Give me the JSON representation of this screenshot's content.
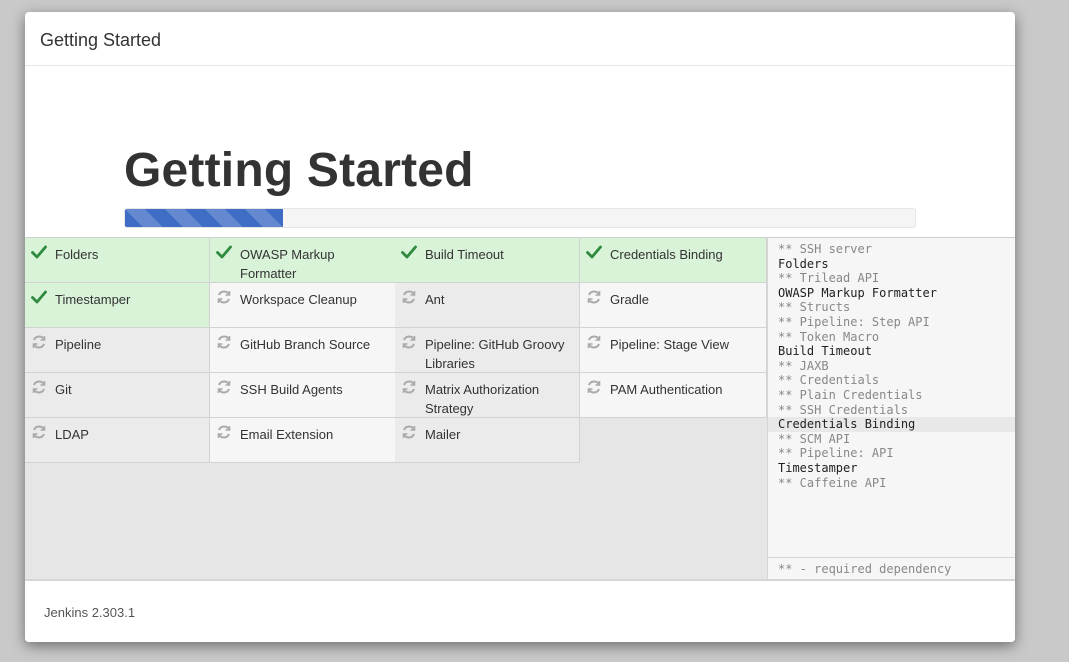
{
  "header": {
    "title": "Getting Started"
  },
  "hero": {
    "title": "Getting Started",
    "progress_fraction": 0.2
  },
  "plugins": [
    {
      "label": "Folders",
      "status": "success",
      "icon": "checkmark-icon"
    },
    {
      "label": "OWASP Markup Formatter",
      "status": "success",
      "icon": "checkmark-icon"
    },
    {
      "label": "Build Timeout",
      "status": "success",
      "icon": "checkmark-icon"
    },
    {
      "label": "Credentials Binding",
      "status": "success",
      "icon": "checkmark-icon"
    },
    {
      "label": "Timestamper",
      "status": "success",
      "icon": "checkmark-icon"
    },
    {
      "label": "Workspace Cleanup",
      "status": "pending",
      "icon": "refresh-icon"
    },
    {
      "label": "Ant",
      "status": "pending",
      "icon": "refresh-icon"
    },
    {
      "label": "Gradle",
      "status": "pending",
      "icon": "refresh-icon"
    },
    {
      "label": "Pipeline",
      "status": "pending",
      "icon": "refresh-icon"
    },
    {
      "label": "GitHub Branch Source",
      "status": "pending",
      "icon": "refresh-icon"
    },
    {
      "label": "Pipeline: GitHub Groovy Libraries",
      "status": "pending",
      "icon": "refresh-icon"
    },
    {
      "label": "Pipeline: Stage View",
      "status": "pending",
      "icon": "refresh-icon"
    },
    {
      "label": "Git",
      "status": "pending",
      "icon": "refresh-icon"
    },
    {
      "label": "SSH Build Agents",
      "status": "pending",
      "icon": "refresh-icon"
    },
    {
      "label": "Matrix Authorization Strategy",
      "status": "pending",
      "icon": "refresh-icon"
    },
    {
      "label": "PAM Authentication",
      "status": "pending",
      "icon": "refresh-icon"
    },
    {
      "label": "LDAP",
      "status": "pending",
      "icon": "refresh-icon"
    },
    {
      "label": "Email Extension",
      "status": "pending",
      "icon": "refresh-icon"
    },
    {
      "label": "Mailer",
      "status": "pending",
      "icon": "refresh-icon"
    }
  ],
  "install_log": {
    "lines": [
      {
        "text": "** SSH server",
        "dep": true
      },
      {
        "text": "Folders",
        "dep": false
      },
      {
        "text": "** Trilead API",
        "dep": true
      },
      {
        "text": "OWASP Markup Formatter",
        "dep": false
      },
      {
        "text": "** Structs",
        "dep": true
      },
      {
        "text": "** Pipeline: Step API",
        "dep": true
      },
      {
        "text": "** Token Macro",
        "dep": true
      },
      {
        "text": "Build Timeout",
        "dep": false
      },
      {
        "text": "** JAXB",
        "dep": true
      },
      {
        "text": "** Credentials",
        "dep": true
      },
      {
        "text": "** Plain Credentials",
        "dep": true
      },
      {
        "text": "** SSH Credentials",
        "dep": true
      },
      {
        "text": "Credentials Binding",
        "dep": false,
        "active": true
      },
      {
        "text": "** SCM API",
        "dep": true
      },
      {
        "text": "** Pipeline: API",
        "dep": true
      },
      {
        "text": "Timestamper",
        "dep": false
      },
      {
        "text": "** Caffeine API",
        "dep": true
      }
    ],
    "footer": "** - required dependency"
  },
  "footer": {
    "version": "Jenkins 2.303.1"
  },
  "colors": {
    "success_bg": "#d9f3d8",
    "success_icon": "#2d8a3e",
    "pending_icon": "#aaaaaa",
    "progress": "#3f6cc4"
  }
}
